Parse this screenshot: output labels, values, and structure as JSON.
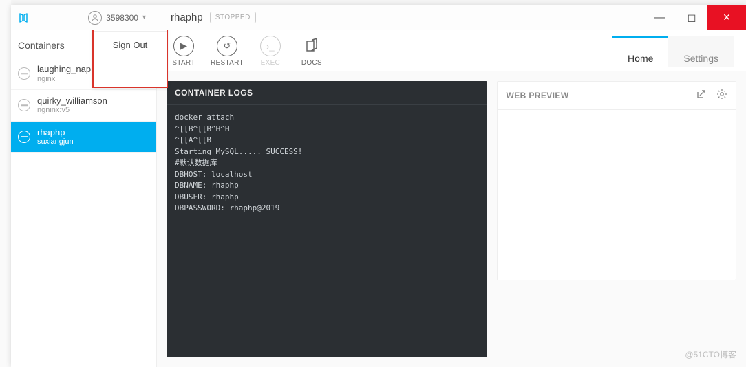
{
  "account": {
    "id": "3598300",
    "signout_label": "Sign Out"
  },
  "title": {
    "container_name": "rhaphp",
    "status_badge": "STOPPED"
  },
  "window_controls": {
    "minimize": "—",
    "maximize": "◻",
    "close": "✕"
  },
  "sidebar": {
    "heading": "Containers",
    "items": [
      {
        "name": "laughing_napier",
        "sub": "nginx",
        "active": false
      },
      {
        "name": "quirky_williamson",
        "sub": "ngninx:v5",
        "active": false
      },
      {
        "name": "rhaphp",
        "sub": "suxiangjun",
        "active": true
      }
    ]
  },
  "toolbar": {
    "start": "START",
    "restart": "RESTART",
    "exec": "EXEC",
    "docs": "DOCS"
  },
  "tabs": {
    "home": "Home",
    "settings": "Settings"
  },
  "panels": {
    "logs_title": "CONTAINER LOGS",
    "logs_body": "docker attach\n^[[B^[[B^H^H\n^[[A^[[B\nStarting MySQL..... SUCCESS!\n#默认数据库\nDBHOST: localhost\nDBNAME: rhaphp\nDBUSER: rhaphp\nDBPASSWORD: rhaphp@2019",
    "preview_title": "WEB PREVIEW"
  },
  "watermark": "@51CTO博客"
}
